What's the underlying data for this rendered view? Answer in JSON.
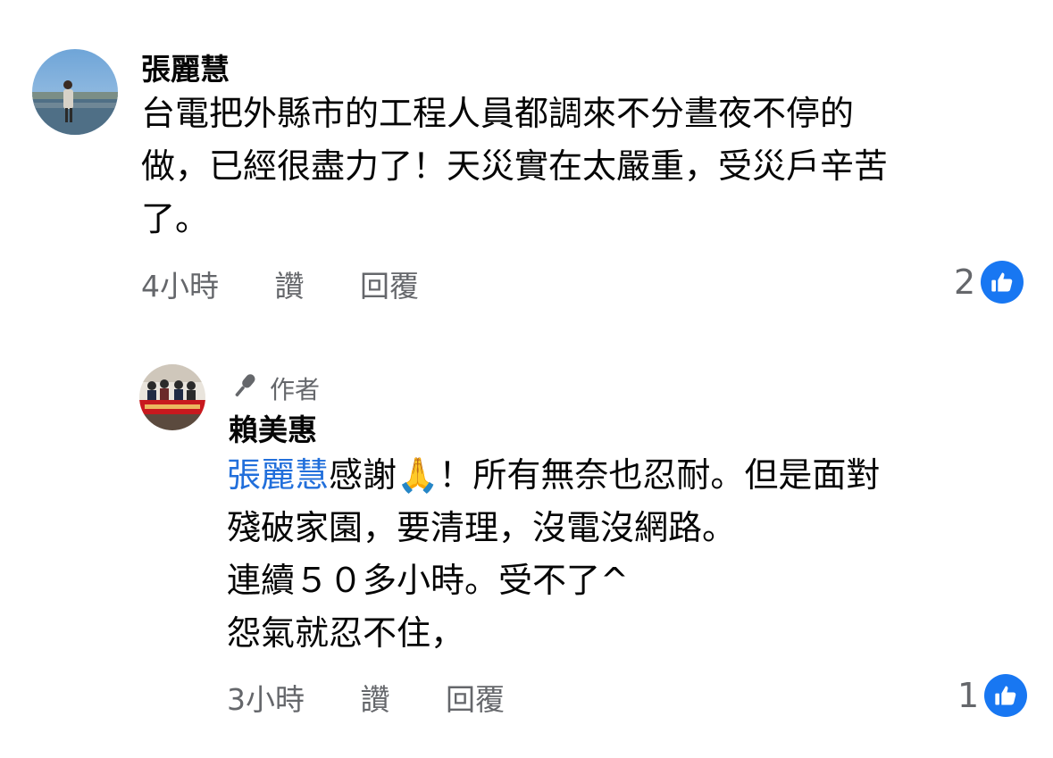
{
  "comments": [
    {
      "author": "張麗慧",
      "text_lines": [
        "台電把外縣市的工程人員都調來不分晝夜不停的",
        "做，已經很盡力了！天災實在太嚴重，受災戶辛苦",
        "了。"
      ],
      "time": "4小時",
      "like_label": "讚",
      "reply_label": "回覆",
      "reaction_count": "2",
      "reaction_icon": "thumbs-up-icon"
    },
    {
      "author_badge": "作者",
      "author_badge_icon": "microphone-icon",
      "author": "賴美惠",
      "mention": "張麗慧",
      "first_line_rest": "感謝🙏！所有無奈也忍耐。但是面對",
      "text_lines": [
        "殘破家園，要清理，沒電沒網路。",
        "連續５０多小時。受不了^",
        "怨氣就忍不住，"
      ],
      "time": "3小時",
      "like_label": "讚",
      "reply_label": "回覆",
      "reaction_count": "1",
      "reaction_icon": "thumbs-up-icon"
    }
  ],
  "colors": {
    "text": "#050505",
    "secondary": "#65676b",
    "mention": "#216fdb",
    "like_blue": "#1877f2"
  }
}
